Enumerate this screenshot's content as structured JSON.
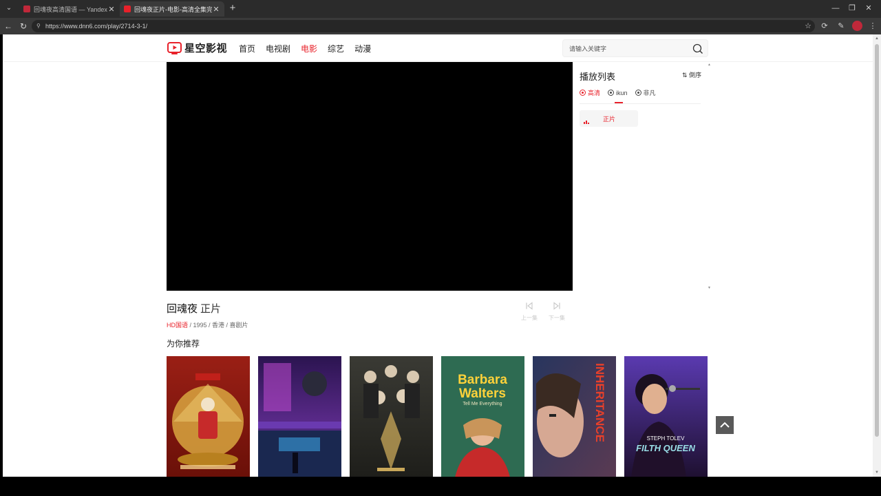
{
  "browser": {
    "tabs": [
      {
        "title": "回魂夜高清国语 — Yandex: found",
        "active": false,
        "favicon_color": "#c0283a"
      },
      {
        "title": "回魂夜正片-电影-高清全集完整版",
        "active": true,
        "favicon_color": "#e8212a"
      }
    ],
    "url": "https://www.dnn6.com/play/2714-3-1/"
  },
  "site": {
    "name": "星空影视",
    "nav": [
      {
        "label": "首页",
        "active": false
      },
      {
        "label": "电视剧",
        "active": false
      },
      {
        "label": "电影",
        "active": true
      },
      {
        "label": "综艺",
        "active": false
      },
      {
        "label": "动漫",
        "active": false
      }
    ],
    "search_placeholder": "请输入关键字",
    "accent_color": "#e8212a"
  },
  "playlist": {
    "title": "播放列表",
    "sort_label": "倒序",
    "sources": [
      {
        "label": "高清",
        "active": true
      },
      {
        "label": "ikun",
        "active": false
      },
      {
        "label": "非凡",
        "active": false
      }
    ],
    "episodes": [
      {
        "label": "正片",
        "active": true
      }
    ]
  },
  "movie": {
    "title": "回魂夜",
    "episode": "正片",
    "tag": "HD国语",
    "meta": " / 1995 / 香港 / 喜剧片",
    "prev_label": "上一集",
    "next_label": "下一集"
  },
  "recommend": {
    "title": "为你推荐",
    "posters": [
      {
        "label": "",
        "colors": [
          "#8a1a12",
          "#d8a640"
        ]
      },
      {
        "label": "",
        "colors": [
          "#3c1d6b",
          "#1f3e7a"
        ]
      },
      {
        "label": "",
        "colors": [
          "#2a2a24",
          "#4e4a3a"
        ]
      },
      {
        "label": "Barbara Walters",
        "sub": "Tell Me Everything",
        "colors": [
          "#2e6b52",
          "#c62a2a"
        ]
      },
      {
        "label": "INHERITANCE",
        "colors": [
          "#2a3a6a",
          "#8a4a5a"
        ]
      },
      {
        "label": "FILTH QUEEN",
        "colors": [
          "#3a2a6a",
          "#2a1a3a"
        ]
      }
    ]
  }
}
